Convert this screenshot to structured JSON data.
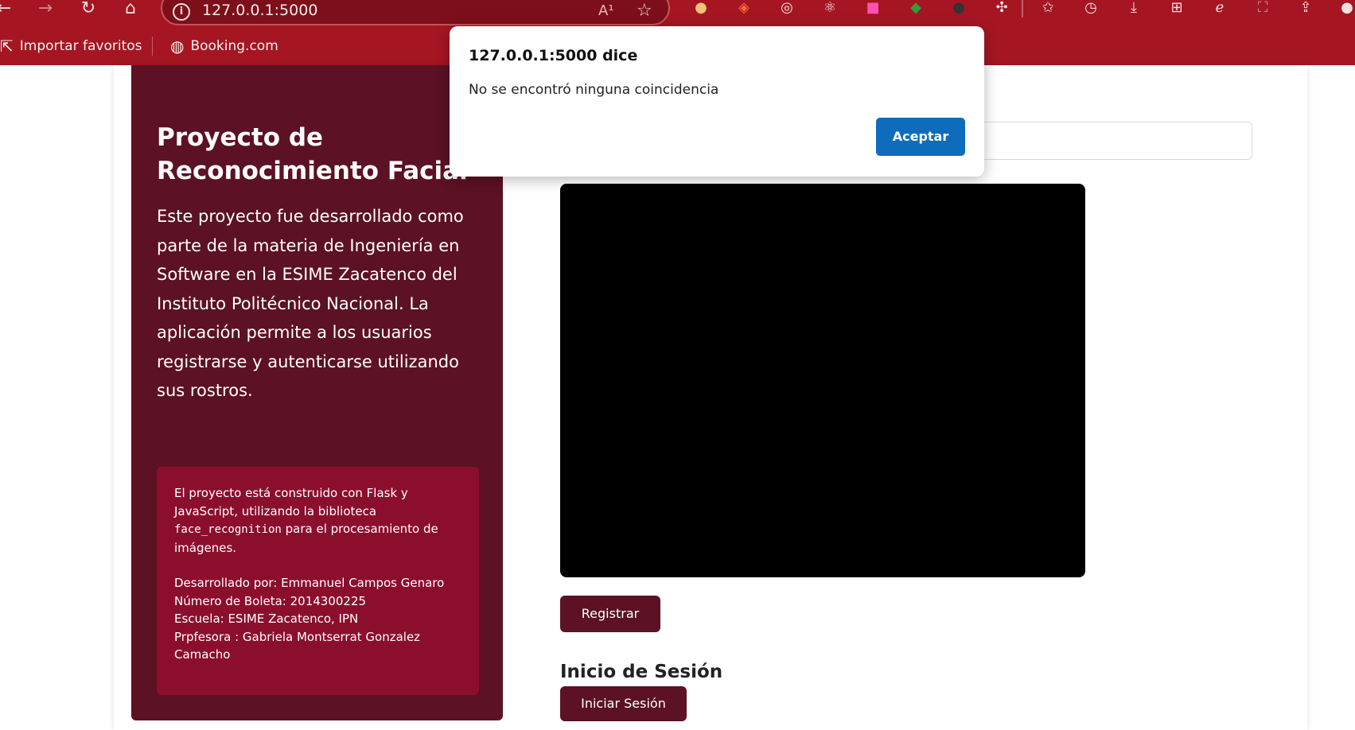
{
  "browser": {
    "address_url": "127.0.0.1:5000",
    "read_aloud_label": "A¹",
    "bookmarks": [
      {
        "label": "Importar favoritos",
        "icon": "import-icon"
      },
      {
        "label": "Booking.com",
        "icon": "globe-icon"
      }
    ],
    "accent_color": "#a51622"
  },
  "page": {
    "hero_title": "Proyecto de Reconocimiento Facial",
    "hero_description": "Este proyecto fue desarrollado como parte de la materia de Ingeniería en Software en la ESIME Zacatenco del Instituto Politécnico Nacional. La aplicación permite a los usuarios registrarse y autenticarse utilizando sus rostros.",
    "info": {
      "intro_before_code": "El proyecto está construido con Flask y JavaScript, utilizando la biblioteca",
      "code": "face_recognition",
      "intro_after_code": "para el procesamiento de imágenes.",
      "developer": "Desarrollado por: Emmanuel Campos Genaro",
      "boleta": "Número de Boleta: 2014300225",
      "school": "Escuela: ESIME Zacatenco, IPN",
      "teacher": "Prpfesora : Gabriela Montserrat Gonzalez Camacho"
    },
    "register_button": "Registrar",
    "login_title": "Inicio de Sesión",
    "login_button": "Iniciar Sesión",
    "panel_color": "#5c1124",
    "info_box_color": "#8b0f2d"
  },
  "dialog": {
    "title": "127.0.0.1:5000 dice",
    "message": "No se encontró ninguna coincidencia",
    "ok_button": "Aceptar",
    "button_color": "#0f6cbd"
  }
}
